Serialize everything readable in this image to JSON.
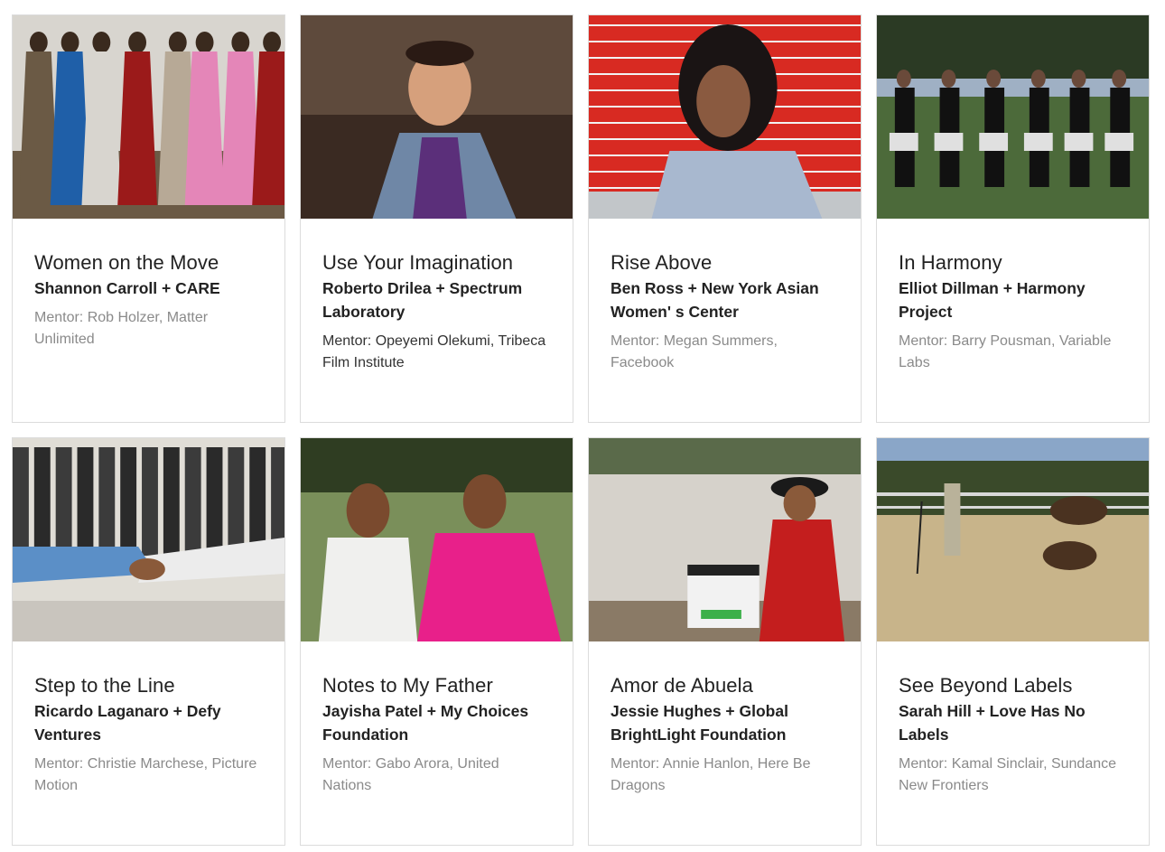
{
  "cards": [
    {
      "title": "Women on the Move",
      "subtitle": "Shannon Carroll + CARE",
      "mentor": "Mentor: Rob Holzer, Matter Unlimited",
      "image_icon": "photo-women-walking",
      "palette": [
        "#b7a996",
        "#d8d5cf",
        "#1f5fa8",
        "#9b1a1a",
        "#e486b8",
        "#6b5a45"
      ]
    },
    {
      "title": "Use Your Imagination",
      "subtitle": "Roberto Drilea + Spectrum Laboratory",
      "mentor": "Mentor: Opeyemi Olekumi, Tribeca Film Institute",
      "mentor_dark": true,
      "image_icon": "photo-man-laughing",
      "palette": [
        "#3a2a22",
        "#5e4a3c",
        "#6f87a6",
        "#5b2f7a",
        "#d6a07c",
        "#e8c4b0"
      ]
    },
    {
      "title": "Rise Above",
      "subtitle": "Ben Ross + New York Asian Women' s Center",
      "mentor": "Mentor: Megan Summers, Facebook",
      "image_icon": "photo-girl-red-wall",
      "palette": [
        "#d82a22",
        "#e6e6e6",
        "#a8b8cf",
        "#1a1414",
        "#8a5a40",
        "#c2c6c9"
      ]
    },
    {
      "title": "In Harmony",
      "subtitle": "Elliot Dillman + Harmony Project",
      "mentor": "Mentor: Barry Pousman, Variable Labs",
      "image_icon": "photo-drumline",
      "palette": [
        "#2b3a24",
        "#4c6a3a",
        "#9fb0c4",
        "#111111",
        "#e0e0e0",
        "#6a7a58"
      ]
    },
    {
      "title": "Step to the Line",
      "subtitle": "Ricardo Laganaro + Defy Ventures",
      "mentor": "Mentor: Christie Marchese, Picture Motion",
      "image_icon": "photo-handshakes",
      "palette": [
        "#c9c5be",
        "#2a2a2a",
        "#5b8fc7",
        "#8a5a3a",
        "#e0ddd6",
        "#3b3b3b"
      ]
    },
    {
      "title": "Notes to My Father",
      "subtitle": "Jayisha Patel + My Choices Foundation",
      "mentor": "Mentor: Gabo Arora, United Nations",
      "image_icon": "photo-father-daughter",
      "palette": [
        "#4f6a3a",
        "#7a8f5a",
        "#f0f0ee",
        "#e8208a",
        "#7a4a2e",
        "#2f3d22"
      ]
    },
    {
      "title": "Amor de Abuela",
      "subtitle": "Jessie Hughes + Global BrightLight Foundation",
      "mentor": "Mentor: Annie Hanlon, Here Be Dragons",
      "image_icon": "photo-boy-clapperboard",
      "palette": [
        "#d6d2cb",
        "#5a6a4a",
        "#c41e1e",
        "#1a2b5a",
        "#f2f2f2",
        "#8a7a66"
      ]
    },
    {
      "title": "See Beyond Labels",
      "subtitle": "Sarah Hill + Love Has No Labels",
      "mentor": "Mentor: Kamal Sinclair, Sundance New Frontiers",
      "image_icon": "photo-horses-field",
      "palette": [
        "#8aa6c8",
        "#5a7a3a",
        "#b59a6a",
        "#4a3220",
        "#c8b48a",
        "#3a4a2a"
      ]
    }
  ]
}
